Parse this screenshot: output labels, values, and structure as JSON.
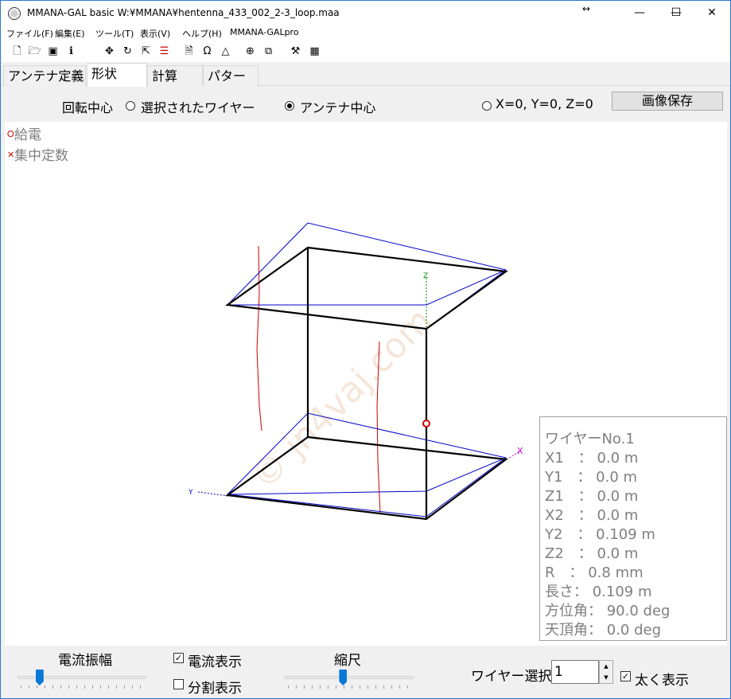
{
  "window": {
    "title": "MMANA-GAL basic W:¥MMANA¥hentenna_433_002_2-3_loop.maa",
    "resize_glyph": "↔",
    "controls": {
      "minimize": "—",
      "maximize": "☐",
      "close": "✕"
    }
  },
  "menu": [
    {
      "label": "ファイル(F)"
    },
    {
      "label": "編集(E)"
    },
    {
      "label": "ツール(T)"
    },
    {
      "label": "表示(V)"
    },
    {
      "label": "ヘルプ(H)"
    },
    {
      "label": "MMANA-GALpro"
    }
  ],
  "toolbar": [
    {
      "icon": "new-file-icon",
      "glyph": "🗋"
    },
    {
      "icon": "open-folder-icon",
      "glyph": "🗁"
    },
    {
      "icon": "save-disk-icon",
      "glyph": "▣"
    },
    {
      "icon": "info-icon",
      "glyph": "ℹ"
    },
    {
      "icon": "move-arrows-icon",
      "glyph": "✥"
    },
    {
      "icon": "rotate-icon",
      "glyph": "↻"
    },
    {
      "icon": "scale-icon",
      "glyph": "⇱"
    },
    {
      "icon": "wire-list-icon",
      "glyph": "☰"
    },
    {
      "icon": "document-icon",
      "glyph": "🗎"
    },
    {
      "icon": "omega-icon",
      "glyph": "Ω"
    },
    {
      "icon": "triangle-icon",
      "glyph": "△"
    },
    {
      "icon": "target-icon",
      "glyph": "⊕"
    },
    {
      "icon": "copy-icon",
      "glyph": "⧉"
    },
    {
      "icon": "tools-icon",
      "glyph": "⚒"
    },
    {
      "icon": "calculator-icon",
      "glyph": "▦"
    }
  ],
  "tabs": [
    {
      "label": "アンテナ定義",
      "active": false
    },
    {
      "label": "形状",
      "active": true
    },
    {
      "label": "計算",
      "active": false
    },
    {
      "label": "パターン",
      "active": false
    }
  ],
  "rotation": {
    "label": "回転中心",
    "option_selected_wire": "選択されたワイヤー",
    "option_antenna_center": "アンテナ中心",
    "option_xyz": "X=0, Y=0, Z=0",
    "selected": "アンテナ中心",
    "save_image": "画像保存"
  },
  "legend": {
    "feed": "給電",
    "feed_color": "#cc0000",
    "load": "集中定数",
    "load_color": "#cc0000"
  },
  "scene": {
    "watermark": "© jn4vaj.com",
    "axis_y_label": "Y",
    "axis_x_label": "X",
    "axis_z_label": "Z",
    "colors": {
      "wire": "#000000",
      "current": "#0000cc",
      "ground": "#cc0000",
      "feed": "#cc0000"
    }
  },
  "wire_info": {
    "title": "ワイヤーNo.1",
    "rows": [
      "X1　：  0.0 m",
      "Y1　：  0.0 m",
      "Z1　：  0.0 m",
      "X2　：  0.0 m",
      "Y2　：  0.109 m",
      "Z2　：  0.0 m",
      "R　：  0.8 mm",
      "長さ：  0.109 m",
      "方位角：  90.0 deg",
      "天頂角：  0.0 deg"
    ]
  },
  "bottom": {
    "current_amplitude": "電流振幅",
    "current_amplitude_level": 0.15,
    "show_current": "電流表示",
    "show_current_checked": true,
    "show_segments": "分割表示",
    "show_segments_checked": false,
    "scale": "縮尺",
    "scale_level": 0.45,
    "wire_select": "ワイヤー選択",
    "wire_select_value": "1",
    "thick_display": "太く表示",
    "thick_display_checked": true
  }
}
